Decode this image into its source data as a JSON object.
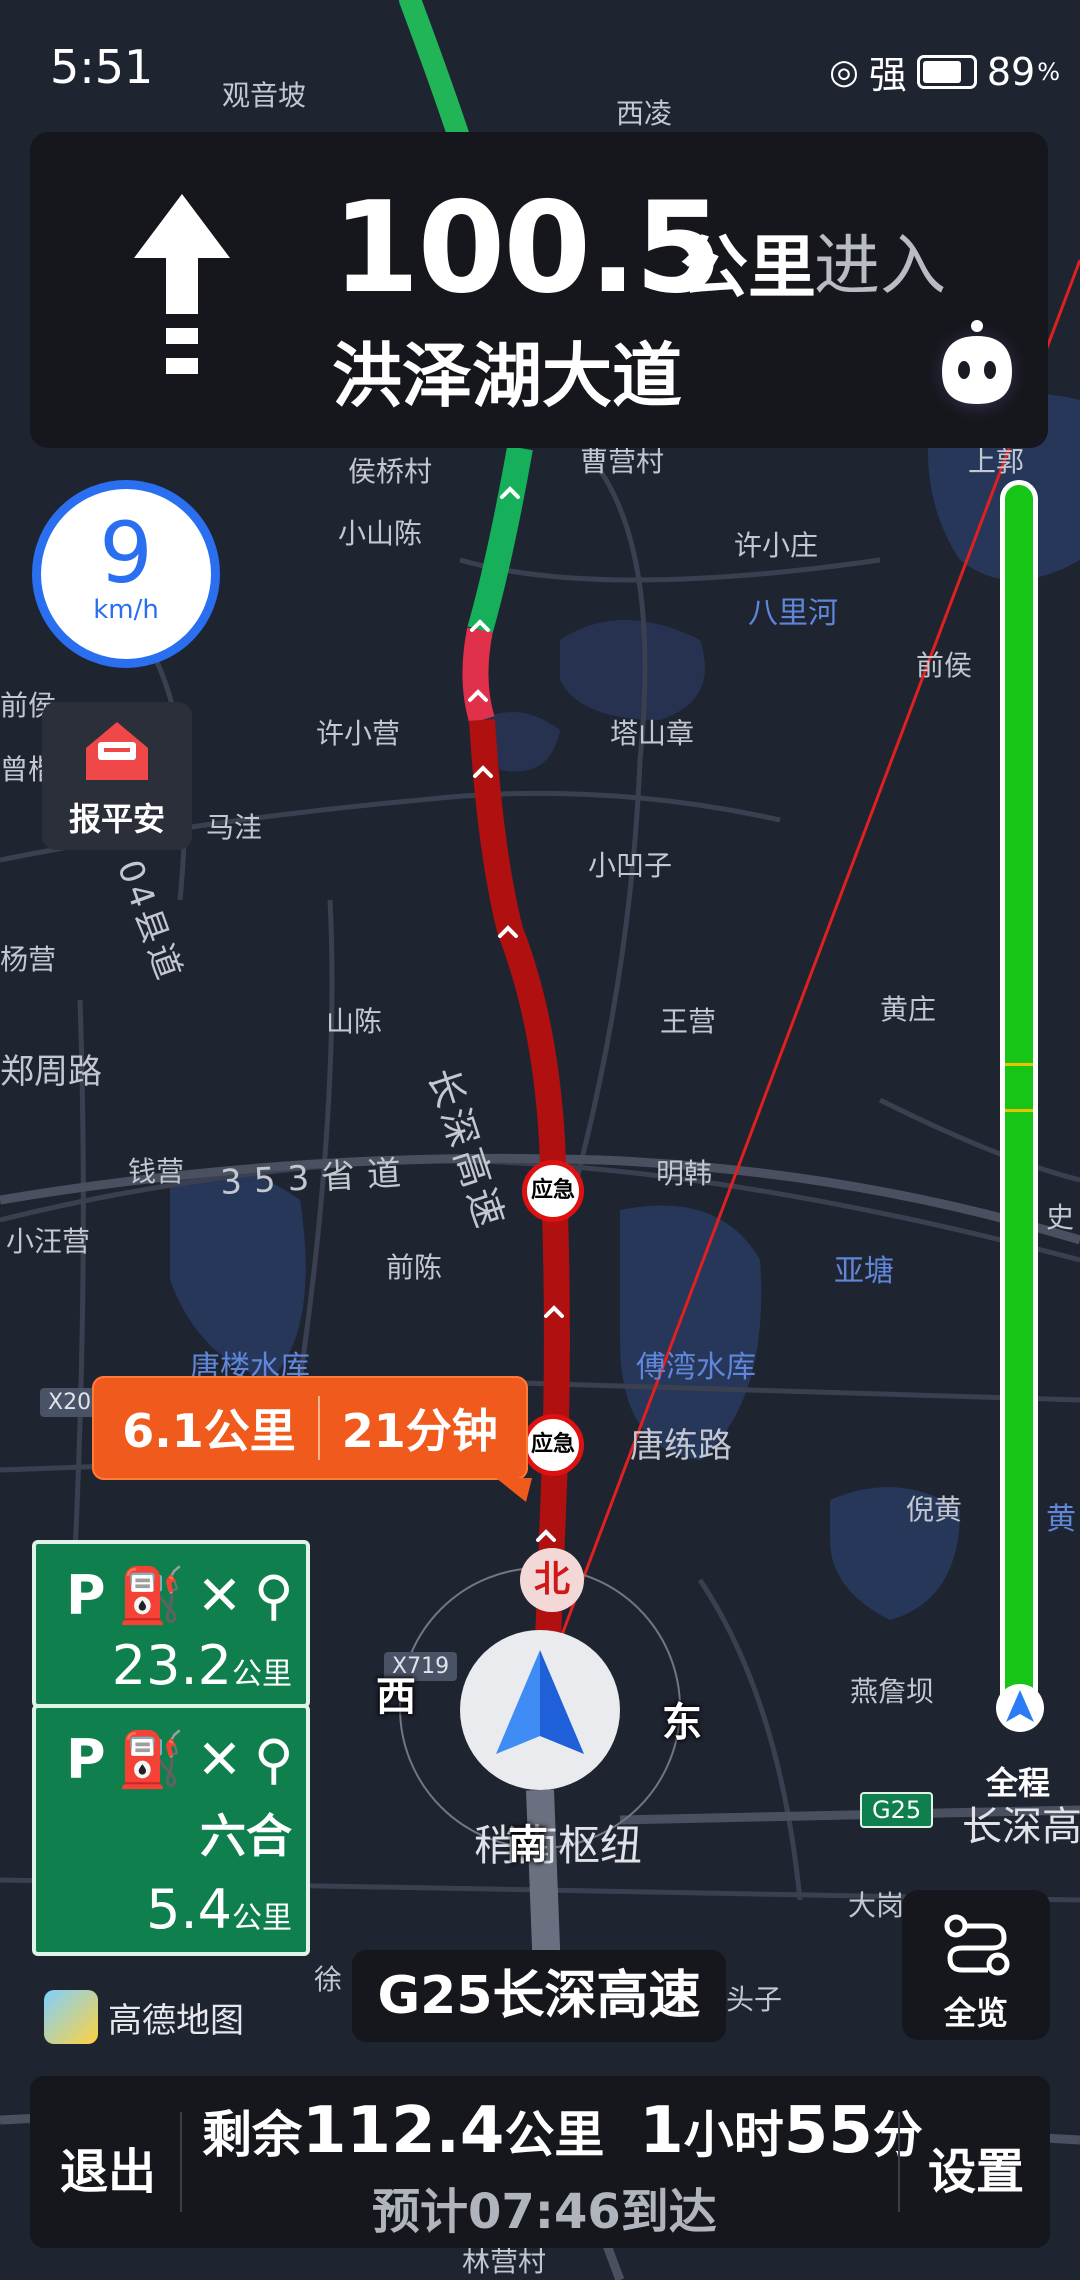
{
  "status_bar": {
    "time": "5:51",
    "signal": "强",
    "battery": "89",
    "battery_unit": "%"
  },
  "guidance": {
    "distance": "100.5",
    "unit": "公里",
    "action": "进入",
    "road": "洪泽湖大道",
    "turn_icon": "straight-arrow-icon",
    "assistant_icon": "assistant-robot-icon"
  },
  "speed": {
    "value": "9",
    "unit": "km/h"
  },
  "safety_button": {
    "label": "报平安"
  },
  "traffic_bubble": {
    "distance": "6.1公里",
    "time": "21分钟"
  },
  "service_areas": [
    {
      "icons": "P⛽✕⚲",
      "distance": "23.2",
      "unit": "公里"
    },
    {
      "icons": "P⛽✕⚲",
      "name": "六合",
      "distance": "5.4",
      "unit": "公里"
    }
  ],
  "compass": {
    "north": "北",
    "south": "南",
    "east": "东",
    "west": "西"
  },
  "progress": {
    "label": "全程",
    "colors": {
      "smooth": "#16c516",
      "congested": "#d61e1e",
      "slow": "#e8c400"
    }
  },
  "map_labels": {
    "places": [
      "观音坡",
      "西凌",
      "侯桥村",
      "曹营村",
      "上郭",
      "小山陈",
      "许小庄",
      "前侯",
      "前侯",
      "许小营",
      "塔山章",
      "曾楷",
      "马洼",
      "小凹子",
      "杨营",
      "山陈",
      "王营",
      "黄庄",
      "钱营",
      "明韩",
      "小汪营",
      "前陈",
      "亚塘",
      "倪黄",
      "燕詹坝",
      "大岗子",
      "头子",
      "徐",
      "林营村",
      "史",
      "黄"
    ],
    "water": [
      "八里河",
      "唐楼水库",
      "傅湾水库"
    ],
    "roads": [
      "长深高速",
      "353省道",
      "04县道",
      "郑周路",
      "唐练路",
      "稍南枢纽",
      "长深高"
    ],
    "badges": [
      "X20",
      "X719",
      "G25",
      "应急",
      "应急"
    ]
  },
  "brand": {
    "logo_text": "高德地图"
  },
  "current_road": "G25长深高速",
  "overview_button": {
    "label": "全览"
  },
  "bottom_bar": {
    "exit": "退出",
    "remain_prefix": "剩余",
    "remain_distance": "112.4",
    "remain_distance_unit": "公里",
    "remain_hours": "1",
    "remain_hours_unit": "小时",
    "remain_minutes": "55",
    "remain_minutes_unit": "分",
    "eta": "预计07:46到达",
    "settings": "设置"
  }
}
